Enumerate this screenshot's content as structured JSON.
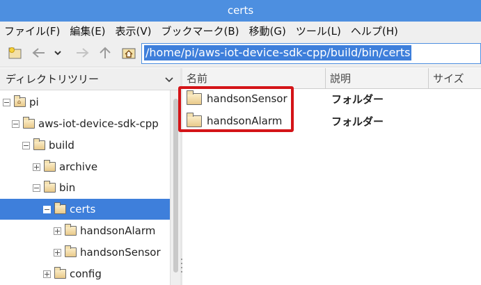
{
  "window": {
    "title": "certs"
  },
  "menu": [
    "ファイル(F)",
    "編集(E)",
    "表示(V)",
    "ブックマーク(B)",
    "移動(G)",
    "ツール(L)",
    "ヘルプ(H)"
  ],
  "toolbar": {
    "icons": [
      "new-window-icon",
      "back-icon",
      "history-dropdown-icon",
      "forward-icon",
      "up-icon",
      "home-icon"
    ],
    "address": "/home/pi/aws-iot-device-sdk-cpp/build/bin/certs"
  },
  "sidebar": {
    "mode_label": "ディレクトリツリー",
    "tree": [
      {
        "label": "pi",
        "expander": "minus",
        "selected": false
      },
      {
        "label": "aws-iot-device-sdk-cpp",
        "expander": "minus",
        "selected": false
      },
      {
        "label": "build",
        "expander": "minus",
        "selected": false
      },
      {
        "label": "archive",
        "expander": "plus",
        "selected": false
      },
      {
        "label": "bin",
        "expander": "minus",
        "selected": false
      },
      {
        "label": "certs",
        "expander": "minus",
        "selected": true
      },
      {
        "label": "handsonAlarm",
        "expander": "plus",
        "selected": false
      },
      {
        "label": "handsonSensor",
        "expander": "plus",
        "selected": false
      },
      {
        "label": "config",
        "expander": "plus",
        "selected": false
      }
    ]
  },
  "file_list": {
    "columns": [
      "名前",
      "説明",
      "サイズ"
    ],
    "rows": [
      {
        "name": "handsonSensor",
        "description": "フォルダー"
      },
      {
        "name": "handsonAlarm",
        "description": "フォルダー"
      }
    ]
  },
  "colors": {
    "titlebar": "#4d8fe0",
    "selection": "#3e7fdb",
    "annotation": "#d41418"
  }
}
